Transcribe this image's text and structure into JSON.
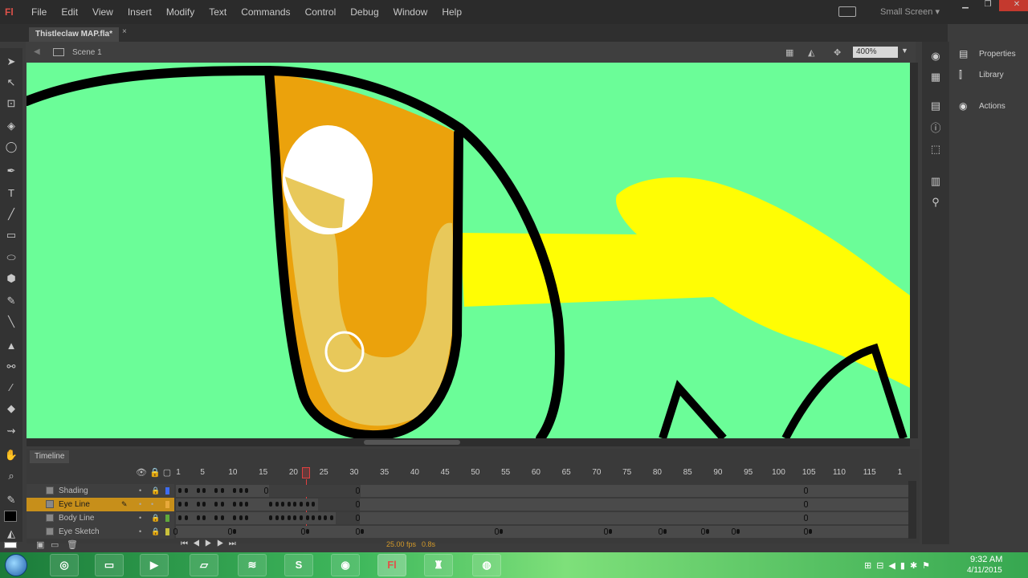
{
  "app": {
    "logo": "Fl"
  },
  "menu": [
    "File",
    "Edit",
    "View",
    "Insert",
    "Modify",
    "Text",
    "Commands",
    "Control",
    "Debug",
    "Window",
    "Help"
  ],
  "workspace": {
    "label": "Small Screen ▾"
  },
  "document": {
    "tab_title": "Thistleclaw MAP.fla*",
    "close_glyph": "×"
  },
  "editbar": {
    "scene_label": "Scene 1",
    "zoom": "400%"
  },
  "tools": [
    "selection-tool",
    "subselection-tool",
    "free-transform-tool",
    "3d-rotation-tool",
    "lasso-tool",
    "pen-tool",
    "text-tool",
    "line-tool",
    "rectangle-tool",
    "oval-tool",
    "polystar-tool",
    "pencil-tool",
    "brush-tool",
    "paint-bucket-tool",
    "bone-tool",
    "eyedropper-tool",
    "eraser-tool",
    "width-tool",
    "hand-tool",
    "zoom-tool"
  ],
  "panels": [
    {
      "label": "Properties",
      "icon": "properties-icon"
    },
    {
      "label": "Library",
      "icon": "library-icon"
    },
    {
      "label": "Actions",
      "icon": "actions-icon"
    }
  ],
  "colors": {
    "stage_bg": "#6bfd98",
    "iris_dark": "#eba20c",
    "iris_light": "#e8c85a",
    "yellow_shape": "#fffd04",
    "outline": "#000000",
    "selected_layer": "#c78f1a",
    "playhead": "#e24040"
  },
  "timeline": {
    "tab_label": "Timeline",
    "ruler": [
      "1",
      "5",
      "10",
      "15",
      "20",
      "25",
      "30",
      "35",
      "40",
      "45",
      "50",
      "55",
      "60",
      "65",
      "70",
      "75",
      "80",
      "85",
      "90",
      "95",
      "100",
      "105",
      "110",
      "115",
      "1"
    ],
    "current_frame": 22,
    "layers": [
      {
        "name": "Shading",
        "selected": false,
        "color": "#3d6cf0"
      },
      {
        "name": "Eye Line",
        "selected": true,
        "color": "#e8a93b"
      },
      {
        "name": "Body Line",
        "selected": false,
        "color": "#5fa93b"
      },
      {
        "name": "Eye Sketch",
        "selected": false,
        "color": "#c9c13c"
      }
    ],
    "fps": "25.00 fps",
    "time": "0.8s"
  },
  "taskbar": {
    "apps": [
      "chrome",
      "explorer",
      "media-player",
      "sticky-notes",
      "spotify",
      "skype",
      "obs",
      "flash",
      "app-8",
      "app-9"
    ],
    "flash_label": "Fl",
    "skype_label": "S",
    "clock_time": "9:32 AM",
    "clock_date": "4/11/2015"
  }
}
